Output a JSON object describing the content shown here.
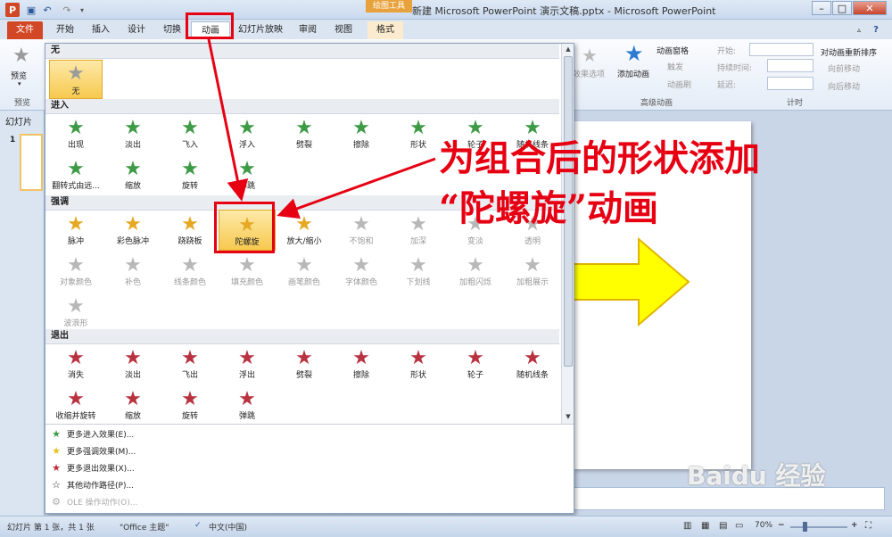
{
  "titlebar": {
    "app_icon": "P",
    "drawing_tools": "绘图工具",
    "title": "新建 Microsoft PowerPoint 演示文稿.pptx - Microsoft PowerPoint",
    "minimize": "–",
    "maximize": "□",
    "close": "✕"
  },
  "tabs": {
    "file": "文件",
    "items": [
      "开始",
      "插入",
      "设计",
      "切换",
      "动画",
      "幻灯片放映",
      "审阅",
      "视图",
      "格式"
    ]
  },
  "ribbon": {
    "preview": "预览",
    "preview_group": "预览",
    "effect_options": "效果选项",
    "add_animation": "添加动画",
    "animation_pane": "动画窗格",
    "trigger": "触发",
    "animation_painter": "动画刷",
    "advanced_group": "高级动画",
    "start": "开始:",
    "duration": "持续时间:",
    "delay": "延迟:",
    "timing_group": "计时",
    "reorder_title": "对动画重新排序",
    "move_earlier": "向前移动",
    "move_later": "向后移动"
  },
  "leftpane": {
    "slides_tab": "幻灯片",
    "slide_number": "1"
  },
  "gallery": {
    "sections": {
      "none": "无",
      "entrance": "进入",
      "emphasis": "强调",
      "exit": "退出"
    },
    "none_item": "无",
    "entrance": [
      "出现",
      "淡出",
      "飞入",
      "浮入",
      "劈裂",
      "擦除",
      "形状",
      "轮子",
      "随机线条",
      "翻转式由远...",
      "缩放",
      "旋转",
      "弹跳"
    ],
    "emphasis": [
      "脉冲",
      "彩色脉冲",
      "跷跷板",
      "陀螺旋",
      "放大/缩小",
      "不饱和",
      "加深",
      "变淡",
      "透明",
      "对象颜色",
      "补色",
      "线条颜色",
      "填充颜色",
      "画笔颜色",
      "字体颜色",
      "下划线",
      "加粗闪烁",
      "加粗展示",
      "波浪形"
    ],
    "exit": [
      "消失",
      "淡出",
      "飞出",
      "浮出",
      "劈裂",
      "擦除",
      "形状",
      "轮子",
      "随机线条",
      "收缩并旋转",
      "缩放",
      "旋转",
      "弹跳"
    ],
    "more": [
      "更多进入效果(E)...",
      "更多强调效果(M)...",
      "更多退出效果(X)...",
      "其他动作路径(P)...",
      "OLE 操作动作(O)..."
    ]
  },
  "annotation": {
    "line1": "为组合后的形状添加",
    "line2": "“陀螺旋”动画"
  },
  "statusbar": {
    "slide_info": "幻灯片 第 1 张，共 1 张",
    "theme": "\"Office 主题\"",
    "language": "中文(中国)",
    "zoom": "70%"
  },
  "watermark": "Baidu 经验",
  "colors": {
    "accent_red": "#e60012",
    "file_tab": "#d24726",
    "shape_yellow": "#ffff00"
  }
}
